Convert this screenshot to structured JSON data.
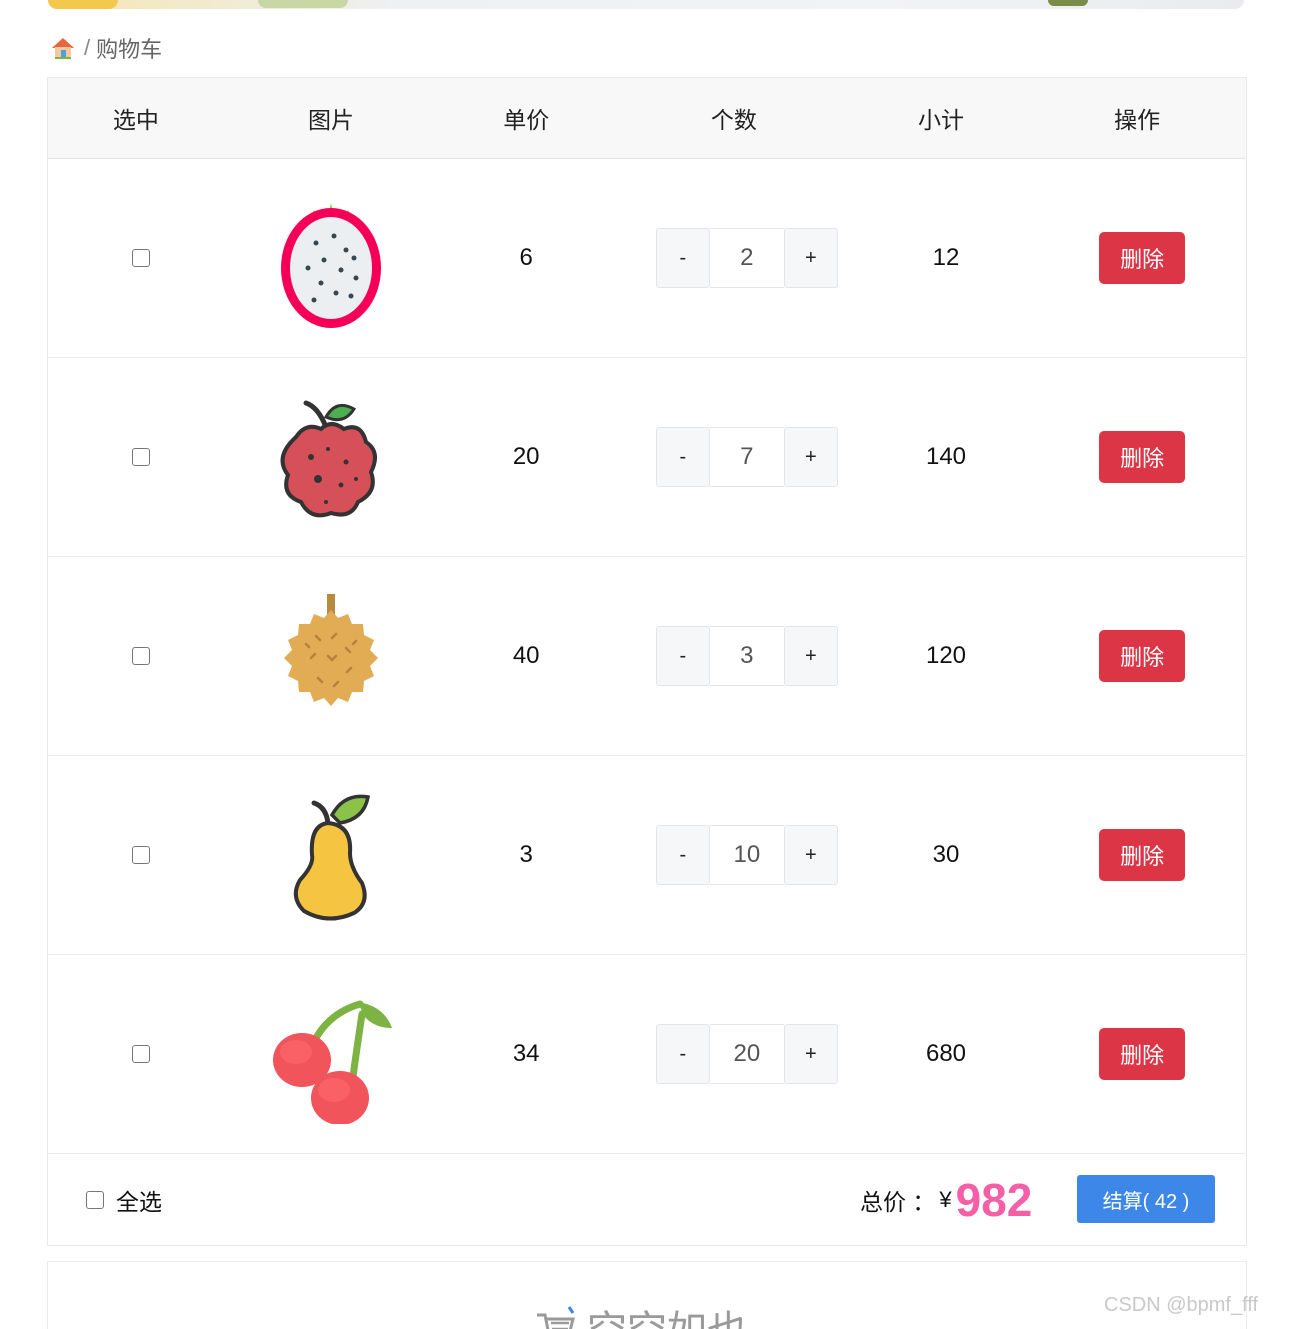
{
  "breadcrumb": {
    "home_icon": "house-icon",
    "separator": "/",
    "current": "购物车"
  },
  "table": {
    "headers": [
      "选中",
      "图片",
      "单价",
      "个数",
      "小计",
      "操作"
    ],
    "rows": [
      {
        "fruit_icon": "dragonfruit",
        "price": "6",
        "qty": "2",
        "subtotal": "12",
        "delete_label": "删除",
        "minus": "-",
        "plus": "+"
      },
      {
        "fruit_icon": "lychee",
        "price": "20",
        "qty": "7",
        "subtotal": "140",
        "delete_label": "删除",
        "minus": "-",
        "plus": "+"
      },
      {
        "fruit_icon": "durian",
        "price": "40",
        "qty": "3",
        "subtotal": "120",
        "delete_label": "删除",
        "minus": "-",
        "plus": "+"
      },
      {
        "fruit_icon": "pear",
        "price": "3",
        "qty": "10",
        "subtotal": "30",
        "delete_label": "删除",
        "minus": "-",
        "plus": "+"
      },
      {
        "fruit_icon": "cherry",
        "price": "34",
        "qty": "20",
        "subtotal": "680",
        "delete_label": "删除",
        "minus": "-",
        "plus": "+"
      }
    ]
  },
  "footer": {
    "select_all_label": "全选",
    "total_label": "总价 ：",
    "currency": "¥",
    "total_amount": "982",
    "checkout_label": "结算( 42 )"
  },
  "empty_cart": {
    "text": "空空如也"
  },
  "watermark": "CSDN @bpmf_fff",
  "colors": {
    "delete": "#dc3545",
    "checkout": "#3c87e8",
    "total_amount": "#f45fa6"
  }
}
